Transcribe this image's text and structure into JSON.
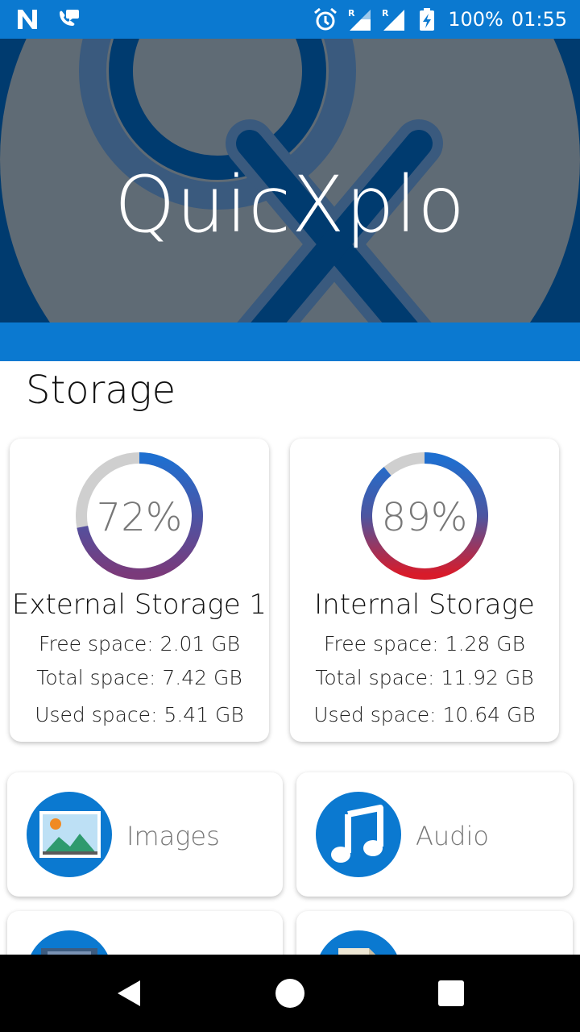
{
  "status_bar": {
    "battery": "100%",
    "time": "01:55",
    "left_icons": [
      "n-notification-icon",
      "wifi-call-icon"
    ],
    "right_icons": [
      "alarm-icon",
      "signal-r-icon",
      "signal-r2-icon",
      "battery-charging-icon"
    ]
  },
  "header": {
    "title": "QuicXplo"
  },
  "storage": {
    "section_title": "Storage",
    "cards": [
      {
        "percent_label": "72%",
        "percent": 72,
        "name": "External Storage 1",
        "free": "Free space: 2.01 GB",
        "total": "Total space: 7.42 GB",
        "used": "Used space: 5.41 GB"
      },
      {
        "percent_label": "89%",
        "percent": 89,
        "name": "Internal Storage",
        "free": "Free space: 1.28 GB",
        "total": "Total space: 11.92 GB",
        "used": "Used space: 10.64 GB"
      }
    ]
  },
  "categories": [
    {
      "label": "Images",
      "icon": "images-icon"
    },
    {
      "label": "Audio",
      "icon": "music-note-icon"
    },
    {
      "label": "",
      "icon": "video-icon"
    },
    {
      "label": "",
      "icon": "document-icon"
    }
  ],
  "colors": {
    "accent": "#0B79D0",
    "header_dark": "#003B6F",
    "ring_track": "#CFCFCF",
    "ring_red": "#D81B2A",
    "ring_blue": "#1E6FD0"
  },
  "nav": [
    "back-icon",
    "home-icon",
    "recents-icon"
  ]
}
